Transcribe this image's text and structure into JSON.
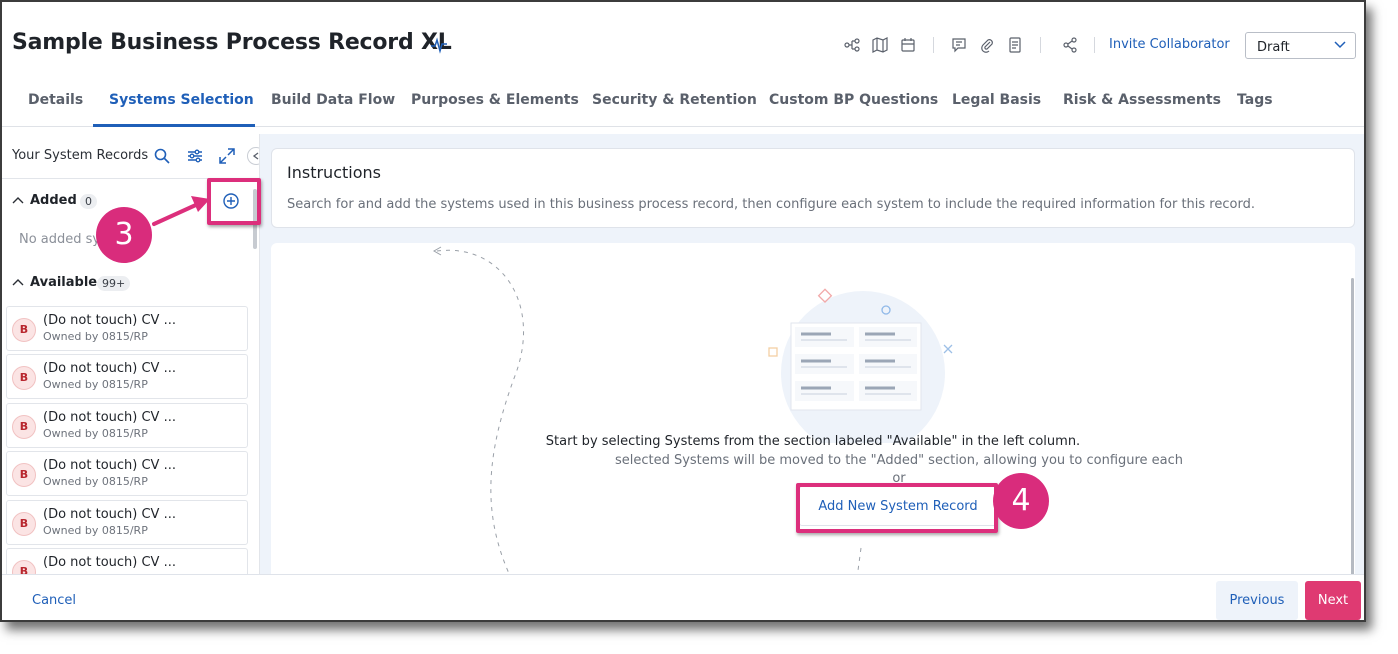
{
  "header": {
    "title": "Sample Business Process Record XL",
    "title_icon": "activity-pulse-icon",
    "toolbar_icons": [
      "flow-icon",
      "map-icon",
      "calendar-icon",
      "comment-icon",
      "attachment-icon",
      "document-icon",
      "share-icon"
    ],
    "invite_label": "Invite Collaborator",
    "status_value": "Draft"
  },
  "tabs": [
    {
      "label": "Details"
    },
    {
      "label": "Systems Selection",
      "active": true
    },
    {
      "label": "Build Data Flow"
    },
    {
      "label": "Purposes & Elements"
    },
    {
      "label": "Security & Retention"
    },
    {
      "label": "Custom BP Questions"
    },
    {
      "label": "Legal Basis"
    },
    {
      "label": "Risk & Assessments"
    },
    {
      "label": "Tags"
    }
  ],
  "sidebar": {
    "title": "Your System Records",
    "added": {
      "label": "Added",
      "count": "0",
      "empty_text": "No added sy"
    },
    "available": {
      "label": "Available",
      "count": "99+"
    },
    "items": [
      {
        "avatar": "B",
        "name": "(Do not touch) CV ...",
        "owner": "Owned by 0815/RP"
      },
      {
        "avatar": "B",
        "name": "(Do not touch) CV ...",
        "owner": "Owned by 0815/RP"
      },
      {
        "avatar": "B",
        "name": "(Do not touch) CV ...",
        "owner": "Owned by 0815/RP"
      },
      {
        "avatar": "B",
        "name": "(Do not touch) CV ...",
        "owner": "Owned by 0815/RP"
      },
      {
        "avatar": "B",
        "name": "(Do not touch) CV ...",
        "owner": "Owned by 0815/RP"
      },
      {
        "avatar": "B",
        "name": "(Do not touch) CV ...",
        "owner": ""
      }
    ]
  },
  "instructions": {
    "title": "Instructions",
    "text": "Search for and add the systems used in this business process record, then configure each system to include the required information for this record."
  },
  "main": {
    "message_primary": "Start by selecting Systems from the section labeled \"Available\" in the left column.",
    "message_secondary": "selected Systems will be moved to the \"Added\" section, allowing you to configure each",
    "or_text": "or",
    "add_button_label": "Add New System Record"
  },
  "footer": {
    "cancel_label": "Cancel",
    "previous_label": "Previous",
    "next_label": "Next"
  },
  "annotations": {
    "step_a": "3",
    "step_b": "4",
    "color": "#dc2f7c"
  },
  "colors": {
    "accent": "#1f5fb8",
    "primary_button": "#df3a72",
    "avatar_bg": "#fbe4e4"
  }
}
